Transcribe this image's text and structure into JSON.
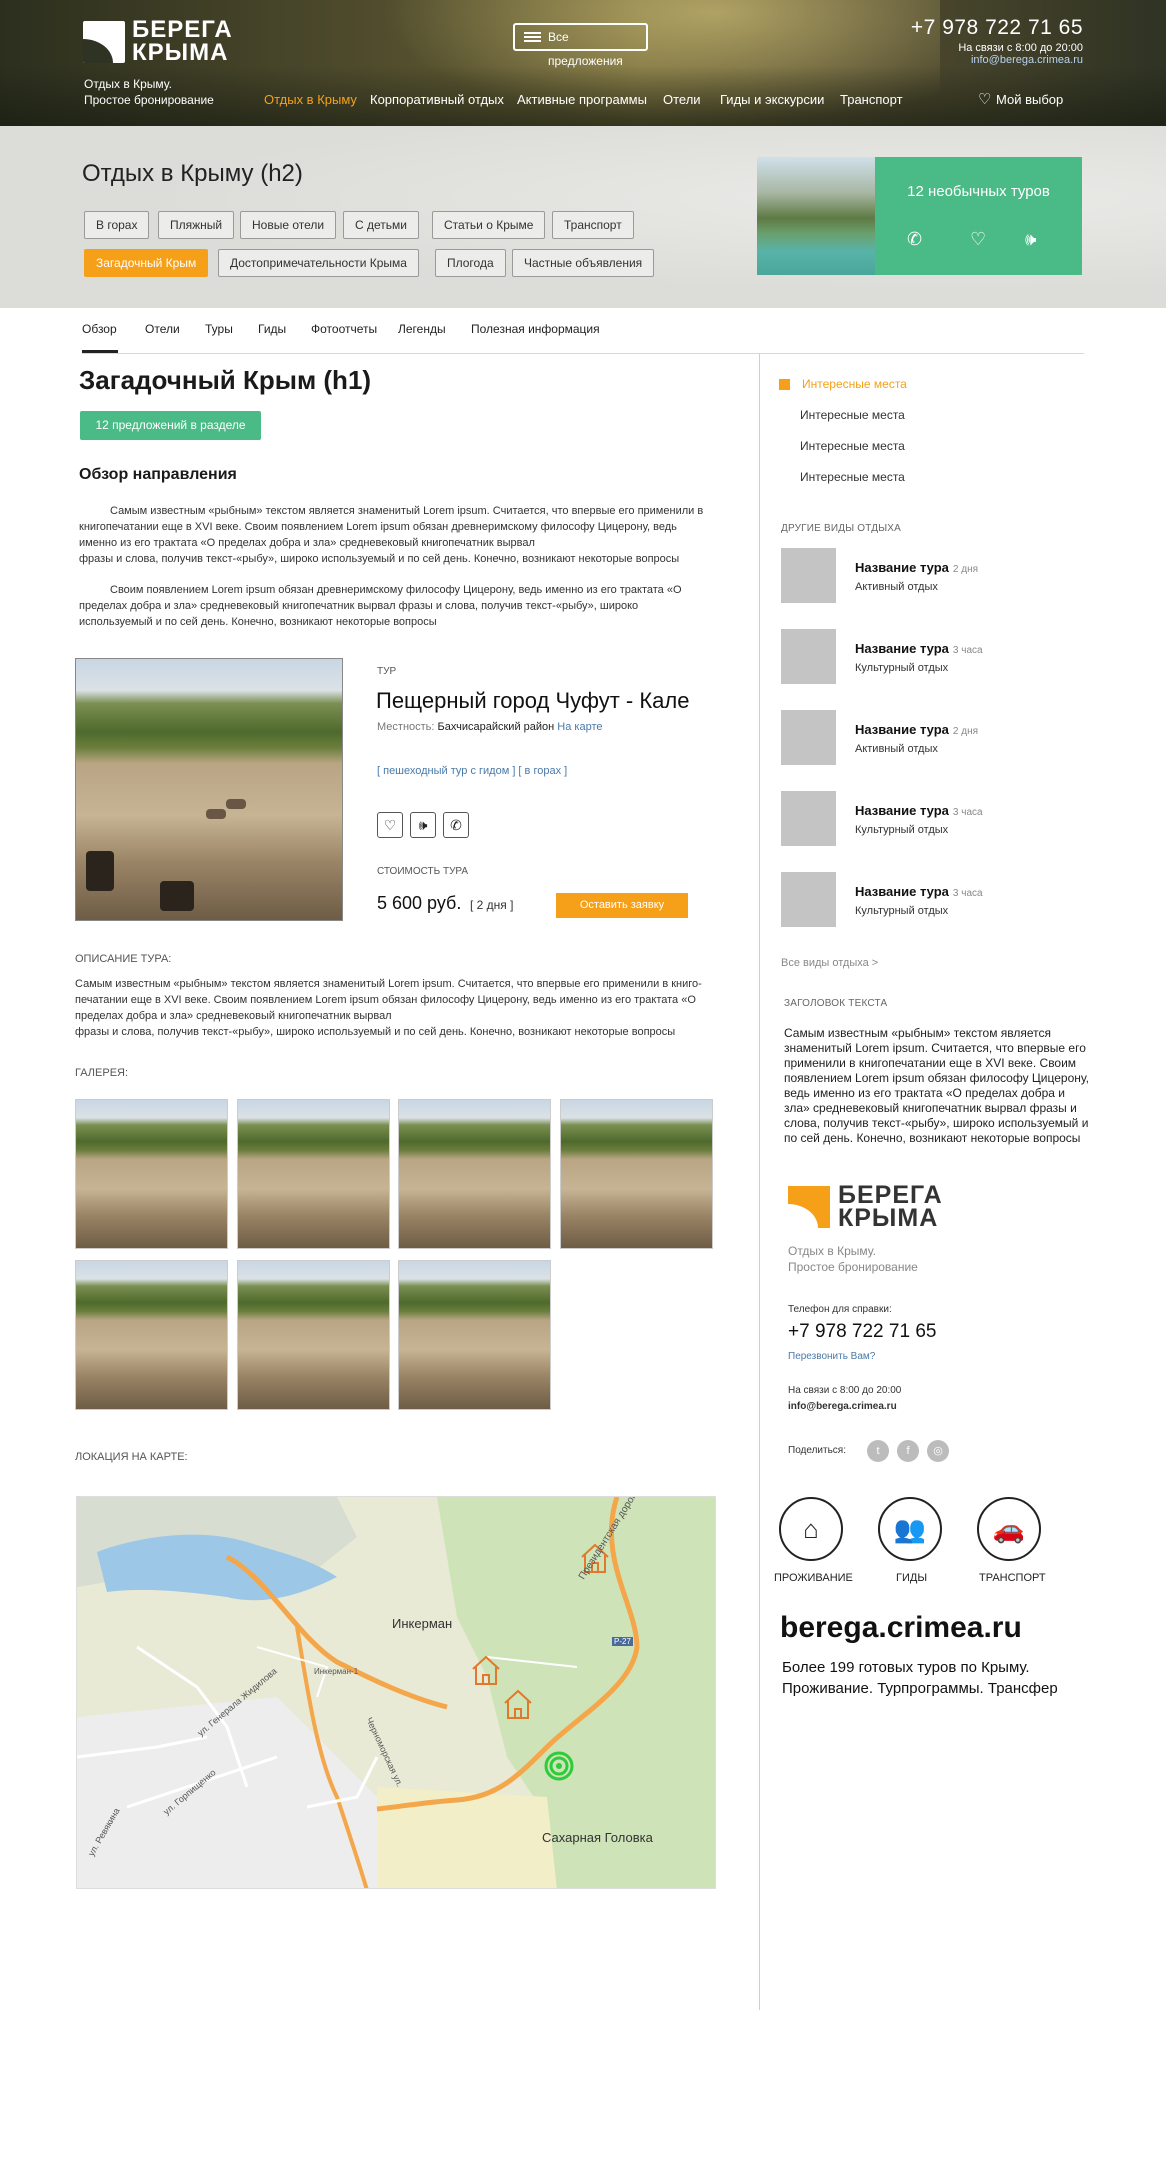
{
  "header": {
    "logo_line1": "БЕРЕГА",
    "logo_line2": "КРЫМА",
    "tagline1": "Отдых в Крыму.",
    "tagline2": "Простое бронирование",
    "menu_button": "Все предложения",
    "phone": "+7 978 722 71 65",
    "hours": "На связи с 8:00 до 20:00",
    "email": "info@berega.crimea.ru",
    "nav": [
      "Отдых в Крыму",
      "Корпоративный отдых",
      "Активные программы",
      "Отели",
      "Гиды и экскурсии",
      "Транспорт"
    ],
    "my_choice": "Мой выбор"
  },
  "band": {
    "title": "Отдых в Крыму (h2)",
    "tags_row1": [
      "В горах",
      "Пляжный",
      "Новые отели",
      "С детьми",
      "Статьи о Крыме",
      "Транспорт"
    ],
    "tags_row2": [
      "Загадочный Крым",
      "Достопримечательности Крыма",
      "Плогода",
      "Частные объявления"
    ],
    "promo": "12 необычных туров"
  },
  "tabs": [
    "Обзор",
    "Отели",
    "Туры",
    "Гиды",
    "Фотоотчеты",
    "Легенды",
    "Полезная информация"
  ],
  "main": {
    "h1": "Загадочный Крым (h1)",
    "offers_button": "12 предложений в разделе",
    "overview_title": "Обзор направления",
    "para1_l1": "Самым известным «рыбным» текстом является знаменитый Lorem ipsum. Считается, что впервые его применили в",
    "para1_l2": "книгопечатании еще в XVI веке. Своим появлением Lorem ipsum обязан древнеримскому философу Цицерону, ведь",
    "para1_l3": "именно из его трактата «О пределах добра и зла» средневековый книгопечатник вырвал",
    "para1_l4": "фразы и слова, получив текст-«рыбу», широко используемый и по сей день. Конечно, возникают некоторые вопросы",
    "para2_l1": "Своим появлением Lorem ipsum обязан древнеримскому философу Цицерону, ведь именно из его трактата «О",
    "para2_l2": "пределах добра и зла» средневековый книгопечатник вырвал фразы и слова, получив текст-«рыбу», широко",
    "para2_l3": "используемый и по сей день. Конечно, возникают некоторые вопросы"
  },
  "tour": {
    "label": "ТУР",
    "name": "Пещерный город Чуфут - Кале",
    "location_label": "Местность:",
    "location": "Бахчисарайский район",
    "map_link": "На карте",
    "tags": "[ пешеходный тур с гидом ] [ в горах ]",
    "cost_label": "СТОИМОСТЬ ТУРА",
    "price": "5 600 руб.",
    "days": "[ 2 дня ]",
    "order": "Оставить заявку"
  },
  "description": {
    "label": "ОПИСАНИЕ ТУРА:",
    "l1": "Самым известным «рыбным» текстом является знаменитый Lorem ipsum. Считается, что впервые его применили в книго-",
    "l2": "печатании еще в XVI веке. Своим появлением Lorem ipsum обязан философу Цицерону, ведь именно из его трактата «О",
    "l3": "пределах добра и зла» средневековый книгопечатник вырвал",
    "l4": "фразы и слова, получив текст-«рыбу», широко используемый и по сей день. Конечно, возникают некоторые вопросы"
  },
  "gallery_label": "ГАЛЕРЕЯ:",
  "map": {
    "label": "ЛОКАЦИЯ НА КАРТЕ:",
    "places": [
      "Инкерман",
      "Сахарная Головка",
      "Президентская дорога",
      "ул. Генерала Жидилова",
      "ул. Горпищенко",
      "ул. Ревякина",
      "Черноморская ул.",
      "Инкерман-1",
      "Р-27"
    ]
  },
  "sidebar": {
    "active": "Интересные места",
    "items": [
      "Интересные места",
      "Интересные места",
      "Интересные места"
    ],
    "other_caption": "ДРУГИЕ ВИДЫ ОТДЫХА",
    "related": [
      {
        "name": "Название тура",
        "dur": "2 дня",
        "type": "Активный отдых"
      },
      {
        "name": "Название тура",
        "dur": "3 часа",
        "type": "Культурный отдых"
      },
      {
        "name": "Название тура",
        "dur": "2 дня",
        "type": "Активный отдых"
      },
      {
        "name": "Название тура",
        "dur": "3 часа",
        "type": "Культурный отдых"
      },
      {
        "name": "Название тура",
        "dur": "3 часа",
        "type": "Культурный отдых"
      }
    ],
    "all_link": "Все виды отдыха >",
    "text_caption": "ЗАГОЛОВОК ТЕКСТА",
    "text": "Самым известным «рыбным» текстом является знаменитый Lorem ipsum. Считается, что впервые его применили в книгопечатании еще в XVI веке. Своим появлением Lorem ipsum обязан философу Цицерону, ведь именно из его трактата «О пределах добра и зла» средневековый книгопечатник вырвал фразы и слова, получив текст-«рыбу», широко используемый и по сей день. Конечно, возникают некоторые вопросы",
    "logo_line1": "БЕРЕГА",
    "logo_line2": "КРЫМА",
    "tagline1": "Отдых в Крыму.",
    "tagline2": "Простое бронирование",
    "phone_label": "Телефон для справки:",
    "phone": "+7 978 722 71 65",
    "callback": "Перезвонить Вам?",
    "hours": "На связи с 8:00 до 20:00",
    "email": "info@berega.crimea.ru",
    "share": "Поделиться:",
    "circles": [
      "ПРОЖИВАНИЕ",
      "ГИДЫ",
      "ТРАНСПОРТ"
    ],
    "site": "berega.crimea.ru",
    "site_desc1": "Более 199 готовых туров по Крыму.",
    "site_desc2": "Проживание. Турпрограммы. Трансфер"
  }
}
